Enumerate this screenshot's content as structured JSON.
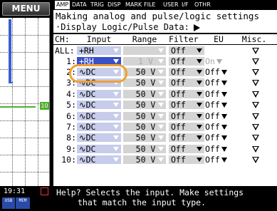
{
  "menu_label": "MENU",
  "tabs": [
    {
      "label": "AMP",
      "active": true
    },
    {
      "label": "DATA",
      "active": false
    },
    {
      "label": "TRIG",
      "active": false
    },
    {
      "label": "DISP",
      "active": false
    },
    {
      "label": "MARK",
      "active": false
    },
    {
      "label": "FILE",
      "active": false
    },
    {
      "label": "USER",
      "active": false
    },
    {
      "label": "I/F",
      "active": false
    },
    {
      "label": "OTHR",
      "active": false
    }
  ],
  "title": "Making analog and pulse/logic settings",
  "subtitle": "·Display Logic/Pulse Data:",
  "columns": {
    "ch": "CH:",
    "input": "Input",
    "range": "Range",
    "filter": "Filter",
    "eu": "EU",
    "misc": "Misc."
  },
  "all_row": {
    "ch": "ALL:",
    "input": "+RH",
    "range": "",
    "filter": "Off"
  },
  "row1": {
    "ch": "1:",
    "input": "+RH",
    "range": "1 V",
    "filter": "Off",
    "eu": "On"
  },
  "rows": [
    {
      "ch": "2:",
      "input": "∿DC",
      "range": "50 V",
      "filter": "Off",
      "eu": "Off"
    },
    {
      "ch": "3:",
      "input": "∿DC",
      "range": "50 V",
      "filter": "Off",
      "eu": "Off"
    },
    {
      "ch": "4:",
      "input": "∿DC",
      "range": "50 V",
      "filter": "Off",
      "eu": "Off"
    },
    {
      "ch": "5:",
      "input": "∿DC",
      "range": "50 V",
      "filter": "Off",
      "eu": "Off"
    },
    {
      "ch": "6:",
      "input": "∿DC",
      "range": "50 V",
      "filter": "Off",
      "eu": "Off"
    },
    {
      "ch": "7:",
      "input": "∿DC",
      "range": "50 V",
      "filter": "Off",
      "eu": "Off"
    },
    {
      "ch": "8:",
      "input": "∿DC",
      "range": "50 V",
      "filter": "Off",
      "eu": "Off"
    },
    {
      "ch": "9:",
      "input": "∿DC",
      "range": "50 V",
      "filter": "Off",
      "eu": "Off"
    },
    {
      "ch": "10:",
      "input": "∿DC",
      "range": "50 V",
      "filter": "Off",
      "eu": "Off"
    }
  ],
  "help_line1": "Help? Selects the input. Make settings",
  "help_line2": "that match the input type.",
  "clock": "19:31",
  "channel_tag": "10",
  "usb_label": "USB",
  "mem_label": "MEM",
  "colors": {
    "selection": "#3a4fc8",
    "field": "#d4d4d4",
    "highlight_ring": "#f0a030",
    "trace_blue": "#3a5fcd",
    "trace_green": "#4caf2a"
  }
}
